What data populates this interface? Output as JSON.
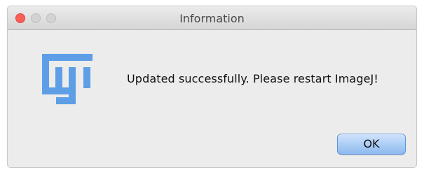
{
  "window": {
    "title": "Information"
  },
  "dialog": {
    "icon": "imagej-fiji-logo-icon",
    "message": "Updated successfully.  Please restart ImageJ!",
    "ok_label": "OK"
  },
  "colors": {
    "close_button": "#fc5f57",
    "inactive_button": "#d3d3d3",
    "logo": "#5e9ee6",
    "ok_button": "#9ec6f5"
  }
}
